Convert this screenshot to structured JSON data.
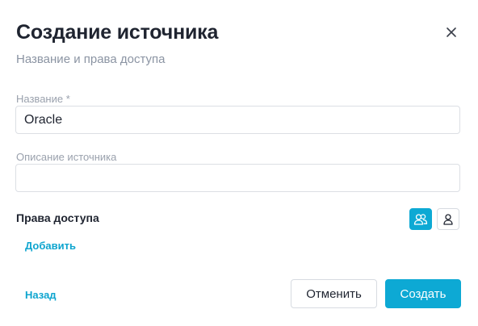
{
  "dialog": {
    "title": "Создание источника",
    "subtitle": "Название и права доступа"
  },
  "form": {
    "name_label": "Название *",
    "name_value": "Oracle",
    "description_label": "Описание источника",
    "description_value": ""
  },
  "access": {
    "label": "Права доступа",
    "add_link": "Добавить",
    "mode_selected": "group"
  },
  "footer": {
    "back_link": "Назад",
    "cancel_label": "Отменить",
    "create_label": "Создать"
  },
  "colors": {
    "accent": "#0da9d4",
    "text": "#1f2430",
    "muted": "#8b94a3",
    "border": "#dcdfe4"
  },
  "icons": {
    "close": "close-icon",
    "group": "users-icon",
    "single": "user-icon"
  }
}
